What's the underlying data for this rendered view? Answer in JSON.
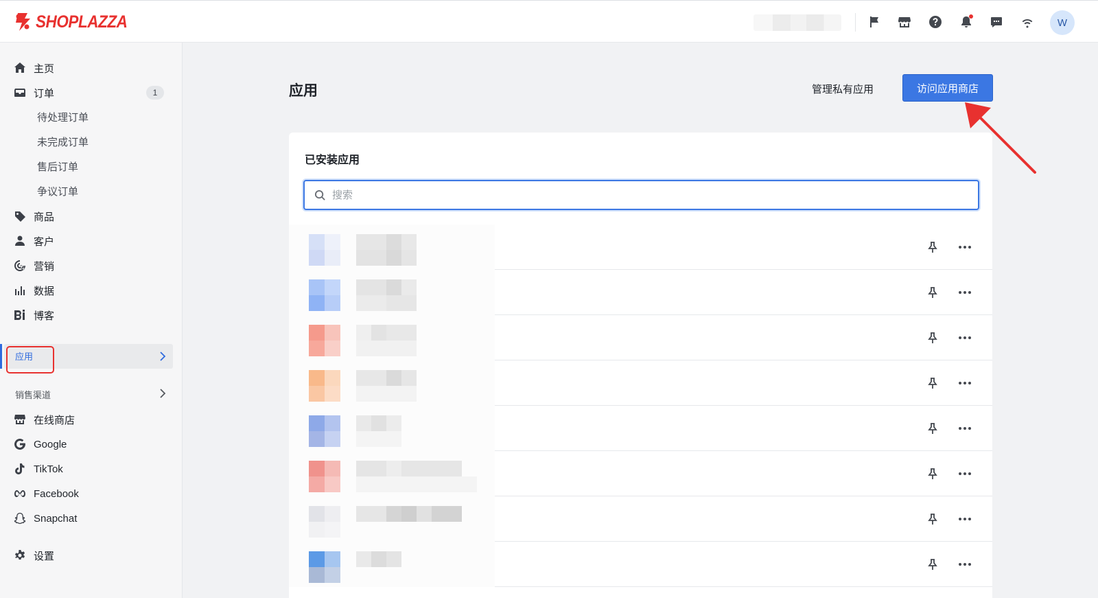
{
  "brand": {
    "name": "SHOPLAZZA",
    "color": "#e8312f"
  },
  "topbar": {
    "icons": [
      "flag-icon",
      "store-icon",
      "help-icon",
      "bell-icon",
      "message-icon",
      "wifi-icon"
    ],
    "avatar_initial": "W"
  },
  "sidebar": {
    "home": "主页",
    "orders": "订单",
    "orders_badge": "1",
    "order_subitems": [
      "待处理订单",
      "未完成订单",
      "售后订单",
      "争议订单"
    ],
    "products": "商品",
    "customers": "客户",
    "marketing": "营销",
    "analytics": "数据",
    "blog": "博客",
    "apps": "应用",
    "sales_channels": "销售渠道",
    "online_store": "在线商店",
    "google": "Google",
    "tiktok": "TikTok",
    "facebook": "Facebook",
    "snapchat": "Snapchat",
    "settings": "设置"
  },
  "main": {
    "title": "应用",
    "private_apps_link": "管理私有应用",
    "visit_store_button": "访问应用商店",
    "installed_title": "已安装应用",
    "search_placeholder": "搜索",
    "accent_color": "#3b77e3"
  }
}
